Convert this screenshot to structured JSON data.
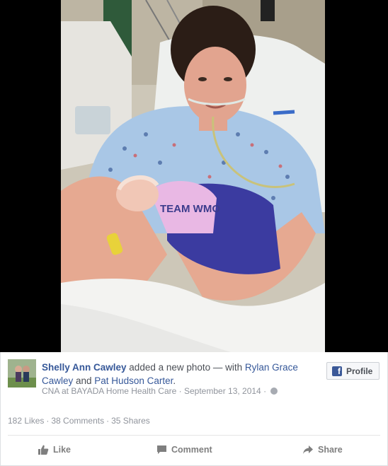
{
  "post": {
    "author": "Shelly Ann Cawley",
    "action_text": " added a new photo — with ",
    "tagged_1": "Rylan Grace Cawley",
    "and_text": " and ",
    "tagged_2": "Pat Hudson Carter",
    "period": ".",
    "job": "CNA at BAYADA Home Health Care",
    "date_separator": " · ",
    "date": "September 13, 2014",
    "privacy_separator": " · ",
    "privacy_icon": "globe-icon"
  },
  "profile_button": {
    "label": "Profile",
    "icon": "facebook-icon"
  },
  "stats": {
    "likes": "182 Likes",
    "comments": "38 Comments",
    "shares": "35 Shares",
    "separator": "·"
  },
  "actions": {
    "like": "Like",
    "comment": "Comment",
    "share": "Share"
  },
  "photo": {
    "shirt_text": "TEAM WMO"
  },
  "colors": {
    "link": "#365899",
    "facebook_blue": "#3b5998",
    "muted": "#90949c"
  }
}
